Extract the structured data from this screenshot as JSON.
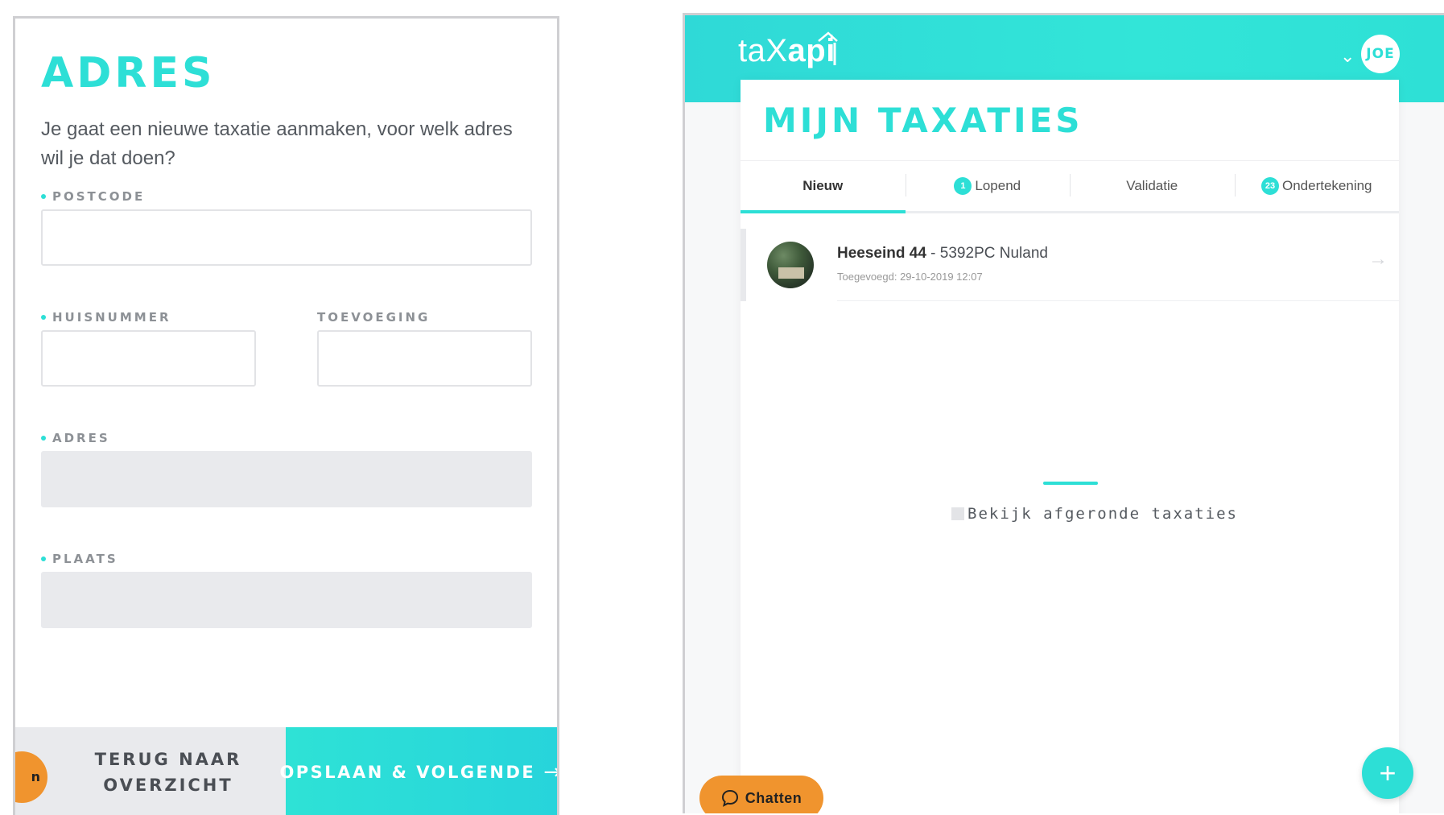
{
  "form": {
    "title": "ADRES",
    "intro": "Je gaat een nieuwe taxatie aanmaken, voor welk adres wil je dat doen?",
    "fields": {
      "postcode": {
        "label": "POSTCODE",
        "value": "",
        "required": true
      },
      "huisnummer": {
        "label": "HUISNUMMER",
        "value": "",
        "required": true
      },
      "toevoeging": {
        "label": "TOEVOEGING",
        "value": "",
        "required": false
      },
      "adres": {
        "label": "ADRES",
        "value": "",
        "required": true,
        "disabled": true
      },
      "plaats": {
        "label": "PLAATS",
        "value": "",
        "required": true,
        "disabled": true
      }
    },
    "back_label_line1": "TERUG NAAR",
    "back_label_line2": "OVERZICHT",
    "next_label": "OPSLAAN & VOLGENDE",
    "next_arrow": "→",
    "bubble_text": "n"
  },
  "app": {
    "logo_prefix": "taX",
    "logo_bold": "api",
    "user_initials": "JOE",
    "page_title": "MIJN TAXATIES",
    "tabs": [
      {
        "label": "Nieuw",
        "badge": "",
        "active": true
      },
      {
        "label": "Lopend",
        "badge": "1",
        "active": false
      },
      {
        "label": "Validatie",
        "badge": "",
        "active": false
      },
      {
        "label": "Ondertekening",
        "badge": "23",
        "active": false
      }
    ],
    "items": [
      {
        "street": "Heeseind 44",
        "separator": " - ",
        "location": "5392PC Nuland",
        "added": "Toegevoegd: 29-10-2019 12:07"
      }
    ],
    "show_completed_label": "Bekijk afgeronde taxaties",
    "fab_label": "+",
    "chat_label": "Chatten"
  },
  "colors": {
    "accent": "#2ddfd6",
    "orange": "#f0942e",
    "disabled_bg": "#e9eaed"
  }
}
